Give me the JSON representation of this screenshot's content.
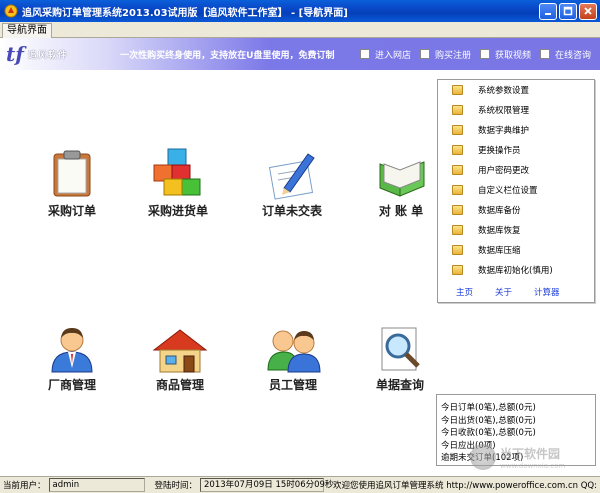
{
  "window": {
    "title": "追风采购订单管理系统2013.03试用版【追风软件工作室】 - [导航界面]"
  },
  "tabs": [
    {
      "label": "导航界面"
    }
  ],
  "banner": {
    "logo_mark": "tf",
    "brand": "追风软件",
    "slogan": "一次性购买终身使用，支持放在U盘里使用，免费订制",
    "links": [
      {
        "label": "进入网店"
      },
      {
        "label": "购买注册"
      },
      {
        "label": "获取视频"
      },
      {
        "label": "在线咨询"
      }
    ]
  },
  "nav": [
    {
      "label": "采购订单",
      "icon": "clipboard-icon"
    },
    {
      "label": "采购进货单",
      "icon": "cubes-icon"
    },
    {
      "label": "订单未交表",
      "icon": "pen-paper-icon"
    },
    {
      "label": "对 账 单",
      "icon": "book-icon"
    },
    {
      "label": "厂商管理",
      "icon": "businessman-icon"
    },
    {
      "label": "商品管理",
      "icon": "house-icon"
    },
    {
      "label": "员工管理",
      "icon": "group-icon"
    },
    {
      "label": "单据查询",
      "icon": "magnifier-icon"
    }
  ],
  "menu": {
    "items": [
      "系统参数设置",
      "系统权限管理",
      "数据字典维护",
      "更换操作员",
      "用户密码更改",
      "自定义栏位设置",
      "数据库备份",
      "数据库恢复",
      "数据库压缩",
      "数据库初始化(慎用)"
    ],
    "links": [
      "主页",
      "关于",
      "计算器"
    ]
  },
  "stats": [
    "今日订单(0笔),总额(0元)",
    "今日出货(0笔),总额(0元)",
    "今日收款(0笔),总额(0元)",
    "今日应出(0项)",
    "逾期未交订单(102项)"
  ],
  "watermark": {
    "text": "当下软件园",
    "sub": "www.downxia.com"
  },
  "statusbar": {
    "user_label": "当前用户：",
    "user_value": "admin",
    "login_label": "登陆时间：",
    "login_value": "2013年07月09日 15时06分09秒",
    "welcome": "欢迎您使用追风订单管理系统 http://www.poweroffice.com.cn QQ:"
  },
  "colors": {
    "titlebar": "#0a47c8",
    "banner": "#7a76e4",
    "link": "#1a3bd8"
  }
}
